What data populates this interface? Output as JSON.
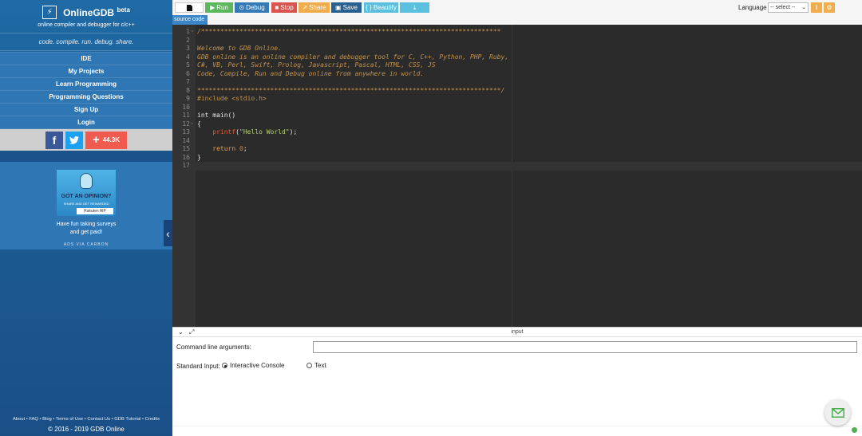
{
  "sidebar": {
    "brand_icon": "⚡",
    "brand_name": "OnlineGDB",
    "brand_badge": "beta",
    "brand_sub": "online compiler and debugger for c/c++",
    "tagline": "code. compile. run. debug. share.",
    "nav": [
      "IDE",
      "My Projects",
      "Learn Programming",
      "Programming Questions",
      "Sign Up",
      "Login"
    ],
    "social": {
      "facebook": "f",
      "twitter": "t",
      "share_count": "44.3K"
    },
    "ad": {
      "headline": "GOT AN OPINION?",
      "subline": "SHARE AND GET REWARDED",
      "sponsor": "Rakuten AIP",
      "text_line1": "Have fun taking surveys",
      "text_line2": "and get paid!",
      "via": "ADS VIA CARBON"
    },
    "footer_links": "About • FAQ • Blog • Terms of Use • Contact Us • GDB Tutorial • Credits",
    "copyright": "© 2016 - 2019 GDB Online"
  },
  "toolbar": {
    "run": "Run",
    "debug": "Debug",
    "stop": "Stop",
    "share": "Share",
    "save": "Save",
    "beautify": "{ } Beautify",
    "language_label": "Language",
    "language_value": "-- select --"
  },
  "file_tab": "source code",
  "editor": {
    "lines": [
      {
        "n": "1",
        "fold": "▾",
        "parts": [
          [
            "c-comment",
            "/******************************************************************************"
          ]
        ]
      },
      {
        "n": "2",
        "parts": []
      },
      {
        "n": "3",
        "parts": [
          [
            "c-comment",
            "Welcome to GDB Online."
          ]
        ]
      },
      {
        "n": "4",
        "parts": [
          [
            "c-comment",
            "GDB online is an online compiler and debugger tool for C, C++, Python, PHP, Ruby,"
          ]
        ]
      },
      {
        "n": "5",
        "parts": [
          [
            "c-comment",
            "C#, VB, Perl, Swift, Prolog, Javascript, Pascal, HTML, CSS, JS"
          ]
        ]
      },
      {
        "n": "6",
        "parts": [
          [
            "c-comment",
            "Code, Compile, Run and Debug online from anywhere in world."
          ]
        ]
      },
      {
        "n": "7",
        "parts": []
      },
      {
        "n": "8",
        "parts": [
          [
            "c-comment",
            "*******************************************************************************/"
          ]
        ]
      },
      {
        "n": "9",
        "parts": [
          [
            "c-pre",
            "#include <stdio.h>"
          ]
        ]
      },
      {
        "n": "10",
        "parts": []
      },
      {
        "n": "11",
        "parts": [
          [
            "c-text",
            "int main()"
          ]
        ]
      },
      {
        "n": "12",
        "fold": "▾",
        "parts": [
          [
            "c-text",
            "{"
          ]
        ]
      },
      {
        "n": "13",
        "parts": [
          [
            "c-text",
            "    "
          ],
          [
            "c-func",
            "printf"
          ],
          [
            "c-text",
            "("
          ],
          [
            "c-str",
            "\"Hello World\""
          ],
          [
            "c-text",
            ");"
          ]
        ]
      },
      {
        "n": "14",
        "parts": []
      },
      {
        "n": "15",
        "parts": [
          [
            "c-text",
            "    "
          ],
          [
            "c-kw",
            "return"
          ],
          [
            "c-text",
            " "
          ],
          [
            "c-num",
            "0"
          ],
          [
            "c-text",
            ";"
          ]
        ]
      },
      {
        "n": "16",
        "parts": [
          [
            "c-text",
            "}"
          ]
        ]
      },
      {
        "n": "17",
        "parts": [],
        "active": true
      }
    ]
  },
  "io": {
    "title": "input",
    "cmd_label": "Command line arguments:",
    "cmd_value": "",
    "stdin_label": "Standard Input:",
    "option_interactive": "Interactive Console",
    "option_text": "Text",
    "selected": "Interactive Console"
  }
}
